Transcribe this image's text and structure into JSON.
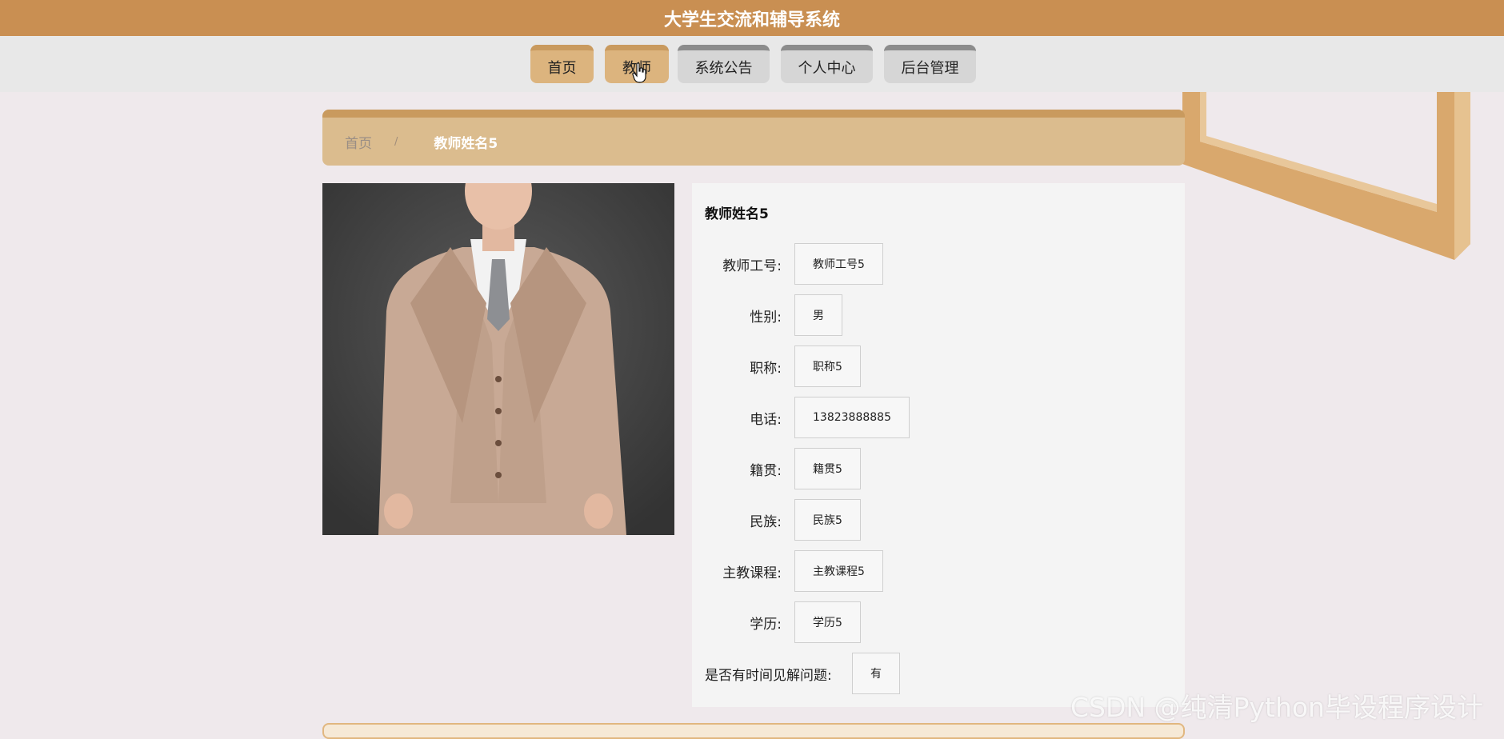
{
  "header": {
    "title": "大学生交流和辅导系统"
  },
  "nav": {
    "items": [
      {
        "label": "首页"
      },
      {
        "label": "教师"
      },
      {
        "label": "系统公告"
      },
      {
        "label": "个人中心"
      },
      {
        "label": "后台管理"
      }
    ],
    "active": "教师"
  },
  "breadcrumb": {
    "home": "首页",
    "separator": "/",
    "current": "教师姓名5"
  },
  "teacher": {
    "name": "教师姓名5",
    "fields": [
      {
        "label": "教师工号:",
        "value": "教师工号5"
      },
      {
        "label": "性别:",
        "value": "男"
      },
      {
        "label": "职称:",
        "value": "职称5"
      },
      {
        "label": "电话:",
        "value": "13823888885"
      },
      {
        "label": "籍贯:",
        "value": "籍贯5"
      },
      {
        "label": "民族:",
        "value": "民族5"
      },
      {
        "label": "主教课程:",
        "value": "主教课程5"
      },
      {
        "label": "学历:",
        "value": "学历5"
      },
      {
        "label": "是否有时间见解问题:",
        "value": "有"
      }
    ]
  },
  "watermark": "CSDN @纯清Python毕设程序设计",
  "colors": {
    "accent": "#c98f52",
    "nav_active": "#dcb47e",
    "nav_inactive": "#d6d6d6",
    "breadcrumb_bg": "#dbbc8e",
    "page_bg": "#efe9ec"
  },
  "icons": {
    "cursor": "hand-pointer-icon"
  }
}
